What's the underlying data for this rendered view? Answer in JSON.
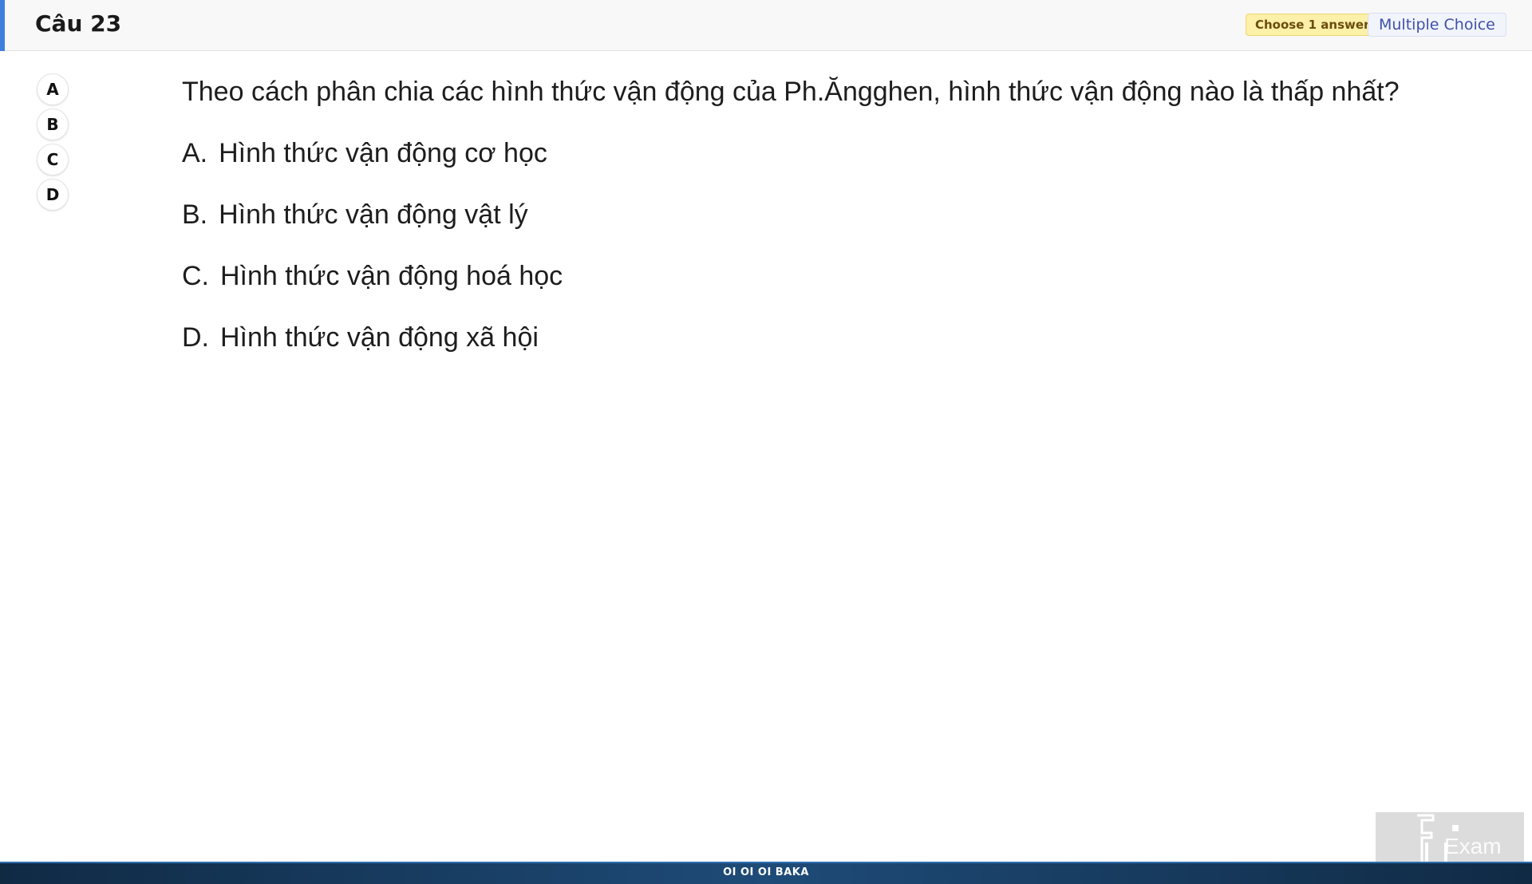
{
  "header": {
    "title": "Câu 23",
    "badge_choose": "Choose 1 answer",
    "badge_type": "Multiple Choice"
  },
  "selector": {
    "options": [
      "A",
      "B",
      "C",
      "D"
    ]
  },
  "question": {
    "text": "Theo cách phân chia các hình thức vận động của Ph.Ăngghen, hình thức vận động nào là thấp nhất?"
  },
  "answers": [
    {
      "letter": "A.",
      "text": "Hình thức vận động cơ học"
    },
    {
      "letter": "B.",
      "text": "Hình thức vận động vật lý"
    },
    {
      "letter": "C.",
      "text": "Hình thức vận động hoá học"
    },
    {
      "letter": "D.",
      "text": "Hình thức vận động xã hội"
    }
  ],
  "footer": {
    "text": "OI OI OI BAKA"
  },
  "logo": {
    "text": "Exam"
  },
  "colors": {
    "accent": "#3f7fe0",
    "badge_choose_bg": "#fdf0a8",
    "badge_type_text": "#3f51a8",
    "footer_bg": "#1e4b78"
  }
}
